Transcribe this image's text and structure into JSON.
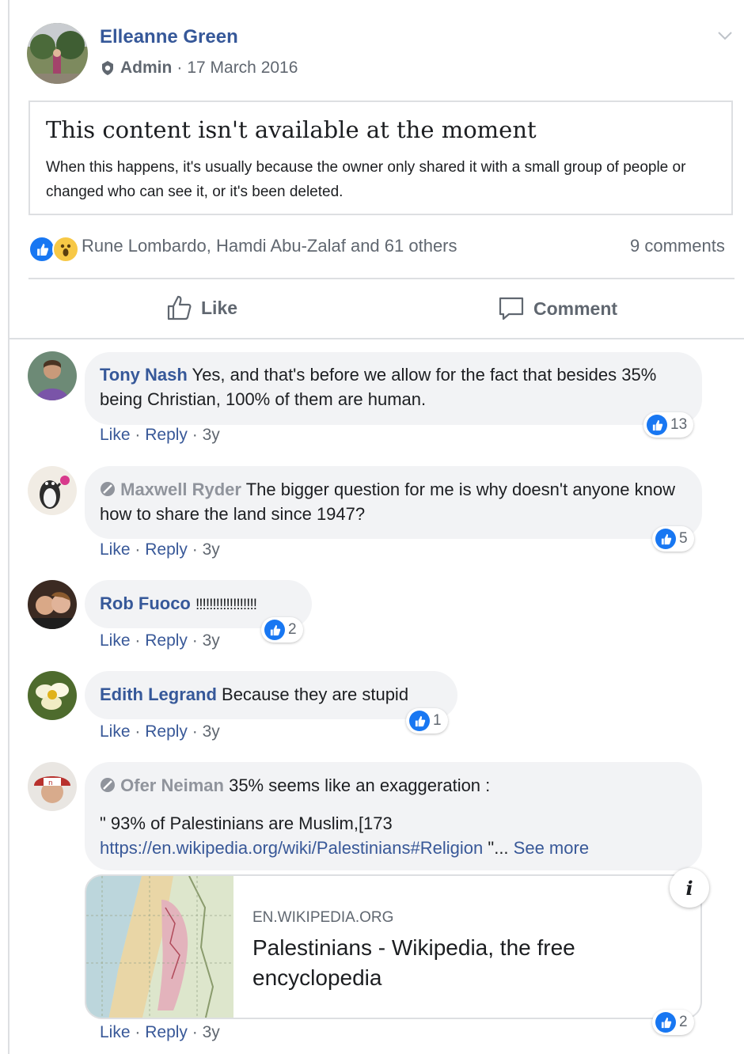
{
  "post": {
    "author": "Elleanne Green",
    "role": "Admin",
    "separator": "·",
    "date": "17 March 2016",
    "notice_title": "This content isn't available at the moment",
    "notice_body": "When this happens, it's usually because the owner only shared it with a small group of people or changed who can see it, or it's been deleted.",
    "reaction_names": "Rune Lombardo, Hamdi Abu-Zalaf and 61 others",
    "comment_count": "9 comments",
    "like_label": "Like",
    "comment_label": "Comment"
  },
  "comment_actions": {
    "like": "Like",
    "reply": "Reply",
    "dot": "·"
  },
  "comments": [
    {
      "author": "Tony Nash",
      "text": "Yes, and that's before we allow for the fact that besides 35% being Christian, 100% of them are human.",
      "age": "3y",
      "likes": "13"
    },
    {
      "author": "Maxwell Ryder",
      "text": "The bigger question for me is why doesn't anyone know how to share the land since 1947?",
      "age": "3y",
      "likes": "5"
    },
    {
      "author": "Rob Fuoco",
      "text": "!!!!!!!!!!!!!!!!!!",
      "age": "3y",
      "likes": "2"
    },
    {
      "author": "Edith Legrand",
      "text": "Because they are stupid",
      "age": "3y",
      "likes": "1"
    },
    {
      "author": "Ofer Neiman",
      "text": "35% seems like an exaggeration :",
      "text2": "\" 93% of Palestinians are Muslim,[173",
      "url": "https://en.wikipedia.org/wiki/Palestinians#Religion",
      "ellipsis": "\"...",
      "see_more": "See more",
      "age": "3y",
      "likes": "2"
    }
  ],
  "link_card": {
    "domain": "EN.WIKIPEDIA.ORG",
    "title": "Palestinians - Wikipedia, the free encyclopedia",
    "info": "i"
  },
  "colors": {
    "link": "#365899",
    "like_blue": "#1877f2",
    "bubble": "#f2f3f5"
  }
}
